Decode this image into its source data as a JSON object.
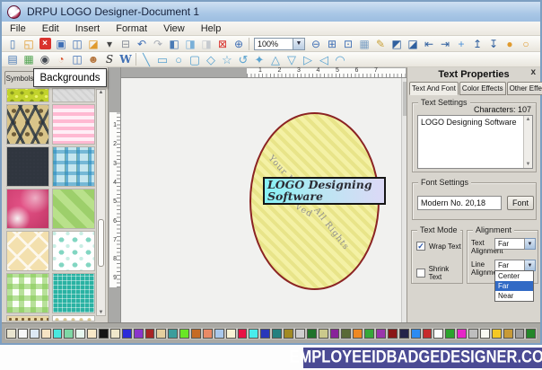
{
  "window": {
    "title": "DRPU LOGO Designer-Document 1"
  },
  "menubar": {
    "items": [
      "File",
      "Edit",
      "Insert",
      "Format",
      "View",
      "Help"
    ]
  },
  "toolbar_main": {
    "zoom_value": "100%",
    "icons_left": [
      {
        "name": "new-document-icon",
        "glyph": "▯",
        "color": "#4a7ab5"
      },
      {
        "name": "open-folder-icon",
        "glyph": "◱",
        "color": "#e09a2e"
      },
      {
        "name": "close-document-icon",
        "glyph": "×",
        "color": "#ffffff",
        "chip": true
      },
      {
        "name": "save-icon",
        "glyph": "▣",
        "color": "#3f6fb5"
      },
      {
        "name": "save-copy-icon",
        "glyph": "◫",
        "color": "#3f6fb5"
      },
      {
        "name": "templates-folder-icon",
        "glyph": "◪",
        "color": "#e09a2e"
      },
      {
        "name": "dropdown-caret-icon",
        "glyph": "▾",
        "color": "#444444"
      },
      {
        "name": "print-icon",
        "glyph": "⊟",
        "color": "#8a8f99"
      },
      {
        "name": "undo-icon",
        "glyph": "↶",
        "color": "#3f6fb5"
      },
      {
        "name": "redo-icon",
        "glyph": "↷",
        "color": "#a8adb5"
      },
      {
        "name": "import-page-icon",
        "glyph": "◧",
        "color": "#4a7ab5"
      },
      {
        "name": "copy-page-icon",
        "glyph": "◨",
        "color": "#7ab0d8"
      },
      {
        "name": "paste-page-icon",
        "glyph": "◨",
        "color": "#c6cacf"
      },
      {
        "name": "delete-page-icon",
        "glyph": "⊠",
        "color": "#d9332e"
      },
      {
        "name": "zoom-in-icon",
        "glyph": "⊕",
        "color": "#3f6fb5"
      }
    ],
    "icons_right": [
      {
        "name": "zoom-out-icon",
        "glyph": "⊖",
        "color": "#3f6fb5"
      },
      {
        "name": "actual-size-icon",
        "glyph": "⊞",
        "color": "#3f6fb5"
      },
      {
        "name": "fit-page-icon",
        "glyph": "⊡",
        "color": "#3f6fb5"
      },
      {
        "name": "grid-icon",
        "glyph": "▦",
        "color": "#7a9fc4"
      },
      {
        "name": "edit-card-icon",
        "glyph": "✎",
        "color": "#c9a138"
      },
      {
        "name": "send-backward-icon",
        "glyph": "◩",
        "color": "#30609f"
      },
      {
        "name": "bring-forward-icon",
        "glyph": "◪",
        "color": "#30609f"
      },
      {
        "name": "align-left-icon",
        "glyph": "⇤",
        "color": "#30609f"
      },
      {
        "name": "align-right-icon",
        "glyph": "⇥",
        "color": "#30609f"
      },
      {
        "name": "center-object-icon",
        "glyph": "+",
        "color": "#4a90d9"
      },
      {
        "name": "align-top-icon",
        "glyph": "↥",
        "color": "#30609f"
      },
      {
        "name": "align-bottom-icon",
        "glyph": "↧",
        "color": "#30609f"
      },
      {
        "name": "lock-icon",
        "glyph": "●",
        "color": "#e09a2e"
      },
      {
        "name": "unlock-icon",
        "glyph": "○",
        "color": "#e09a2e"
      }
    ]
  },
  "toolbar_insert": {
    "icons": [
      {
        "name": "insert-image-icon",
        "glyph": "▤",
        "color": "#4a7ab5"
      },
      {
        "name": "insert-picture-icon",
        "glyph": "▦",
        "color": "#4fa34f"
      },
      {
        "name": "camera-icon",
        "glyph": "◉",
        "color": "#464c54"
      },
      {
        "name": "color-wheel-icon",
        "glyph": "◔",
        "color": "#d9542e"
      },
      {
        "name": "insert-shape-icon",
        "glyph": "◫",
        "color": "#3f6fb5"
      },
      {
        "name": "users-icon",
        "glyph": "☻",
        "color": "#b5763f"
      },
      {
        "name": "signature-icon",
        "glyph": "S",
        "color": "#2a2a2a"
      },
      {
        "name": "wordart-icon",
        "glyph": "W",
        "color": "#3f6fb5"
      }
    ],
    "shapes": [
      {
        "name": "line-tool-icon",
        "glyph": "╲"
      },
      {
        "name": "rectangle-tool-icon",
        "glyph": "▭"
      },
      {
        "name": "ellipse-tool-icon",
        "glyph": "○"
      },
      {
        "name": "rounded-rect-tool-icon",
        "glyph": "▢"
      },
      {
        "name": "diamond-tool-icon",
        "glyph": "◇"
      },
      {
        "name": "star-tool-icon",
        "glyph": "☆"
      },
      {
        "name": "swirl-tool-icon",
        "glyph": "↺"
      },
      {
        "name": "concave-star-tool-icon",
        "glyph": "✦"
      },
      {
        "name": "triangle-tool-icon",
        "glyph": "△"
      },
      {
        "name": "inverted-triangle-tool-icon",
        "glyph": "▽"
      },
      {
        "name": "right-triangle-tool-icon",
        "glyph": "▷"
      },
      {
        "name": "left-triangle-tool-icon",
        "glyph": "◁"
      },
      {
        "name": "arc-tool-icon",
        "glyph": "◠"
      }
    ]
  },
  "left_panel": {
    "tab_symbols": "Symbols",
    "tooltip": "Backgrounds",
    "swatch_patterns": [
      "dots-yellow",
      "plain-gray",
      "geometric",
      "pink-stripes",
      "navy",
      "blue-plaid",
      "pink-watercolor",
      "green-diagonal",
      "cream-lattice",
      "teal-dots",
      "green-gingham",
      "teal-grid",
      "beads",
      "white-dots"
    ]
  },
  "rulers": {
    "horizontal": [
      "1",
      "2",
      "3",
      "4",
      "5",
      "6",
      "7"
    ],
    "vertical": [
      "1",
      "2",
      "3",
      "4",
      "5",
      "6",
      "7",
      "8",
      "9"
    ]
  },
  "canvas": {
    "logo_text": "LOGO Designing Software",
    "arc_segments": [
      {
        "name": "arc-text-your-name",
        "text": "Your N"
      },
      {
        "name": "arc-text-reserved",
        "text": "ved"
      },
      {
        "name": "arc-text-all-rights",
        "text": "All Rights"
      }
    ],
    "colors": {
      "ellipse_fill": "#f4f1a5",
      "ellipse_stripe": "#e8e489",
      "ellipse_border": "#8b2323",
      "box_gradient_start": "#87f2f6",
      "box_gradient_end": "#dcd9f6"
    }
  },
  "right_panel": {
    "title": "Text Properties",
    "close_label": "x",
    "tabs": [
      "Text And Font",
      "Color Effects",
      "Other Effects"
    ],
    "active_tab": "Text And Font",
    "text_settings": {
      "legend": "Text Settings",
      "characters": "Characters: 107",
      "content": "LOGO Designing Software"
    },
    "font_settings": {
      "legend": "Font Settings",
      "font_name": "Modern No. 20,18",
      "font_button": "Font"
    },
    "text_mode": {
      "legend": "Text Mode",
      "wrap_label": "Wrap Text",
      "wrap_checked": true,
      "shrink_label": "Shrink Text",
      "shrink_checked": false
    },
    "alignment": {
      "legend": "Alignment",
      "text_alignment_label": "Text Alignment",
      "text_alignment_value": "Far",
      "line_alignment_label": "Line Alignment",
      "line_alignment_value": "Far",
      "options": [
        "Center",
        "Far",
        "Near"
      ],
      "highlighted_option": "Far"
    }
  },
  "palette": {
    "colors": [
      "#e9e4cf",
      "#f7f7f7",
      "#dde9f4",
      "#f6e4c4",
      "#49e8de",
      "#7ed8a6",
      "#e7f7ef",
      "#f8e8c7",
      "#151515",
      "#efe7cb",
      "#2b2bd8",
      "#8a35cb",
      "#a82424",
      "#e5cf9e",
      "#3b9d9c",
      "#69e625",
      "#c56a23",
      "#e98a66",
      "#a9c8ec",
      "#f8f3d5",
      "#e81145",
      "#49ecec",
      "#2837ba",
      "#23807f",
      "#a18a23",
      "#cfcfcf",
      "#20732a",
      "#cbc98c",
      "#88229a",
      "#5a6a36",
      "#ee8823",
      "#36a839",
      "#9a35ac",
      "#8a1616",
      "#23234a",
      "#2c8bf1",
      "#c62b2b",
      "#fdfdfd",
      "#2ba32c",
      "#e626c7",
      "#bebebe",
      "#f8f8f2",
      "#f5c823",
      "#c89a36",
      "#9e9e9e",
      "#238729"
    ]
  },
  "footer": {
    "site": "EMPLOYEEIDBADGEDESIGNER.COM"
  }
}
